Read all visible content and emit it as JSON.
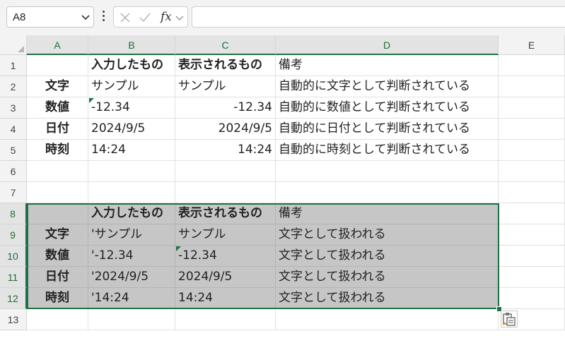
{
  "formula_bar": {
    "name_box": "A8",
    "cancel_icon": "x-icon",
    "enter_icon": "check-icon",
    "fx_label": "fx",
    "formula_value": ""
  },
  "columns": [
    "A",
    "B",
    "C",
    "D",
    "E"
  ],
  "selected_column": "D",
  "rows": [
    "1",
    "2",
    "3",
    "4",
    "5",
    "6",
    "7",
    "8",
    "9",
    "10",
    "11",
    "12",
    "13"
  ],
  "table1": {
    "header": [
      "",
      "入力したもの",
      "表示されるもの",
      "備考"
    ],
    "rows": [
      {
        "label": "文字",
        "input": "サンプル",
        "display": "サンプル",
        "note": "自動的に文字として判断されている"
      },
      {
        "label": "数値",
        "input": "-12.34",
        "display": "-12.34",
        "note": "自動的に数値として判断されている"
      },
      {
        "label": "日付",
        "input": "2024/9/5",
        "display": "2024/9/5",
        "note": "自動的に日付として判断されている"
      },
      {
        "label": "時刻",
        "input": "14:24",
        "display": "14:24",
        "note": "自動的に時刻として判断されている"
      }
    ]
  },
  "table2": {
    "header": [
      "",
      "入力したもの",
      "表示されるもの",
      "備考"
    ],
    "rows": [
      {
        "label": "文字",
        "input": "'サンプル",
        "display": "サンプル",
        "note": "文字として扱われる"
      },
      {
        "label": "数値",
        "input": "'-12.34",
        "display": "-12.34",
        "note": "文字として扱われる"
      },
      {
        "label": "日付",
        "input": "'2024/9/5",
        "display": "2024/9/5",
        "note": "文字として扱われる"
      },
      {
        "label": "時刻",
        "input": "'14:24",
        "display": "14:24",
        "note": "文字として扱われる"
      }
    ]
  },
  "colors": {
    "selection": "#1e7145",
    "shade": "#c6c6c6",
    "header_bg": "#f3f3f3"
  },
  "paste_options_icon": "paste-options-icon"
}
